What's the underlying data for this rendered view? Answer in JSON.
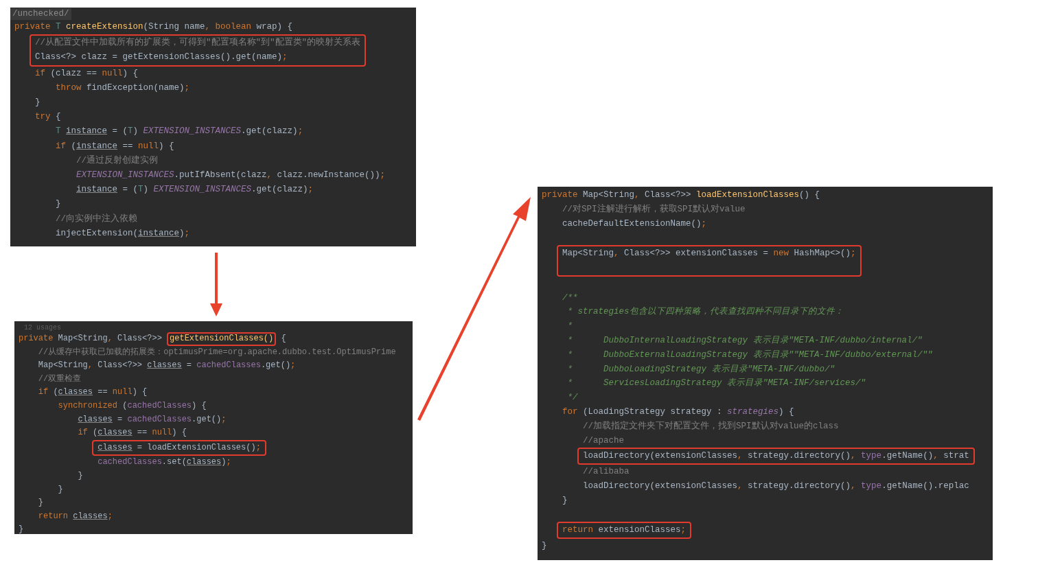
{
  "panels": [
    {
      "header": "/unchecked/",
      "blocks": [
        {
          "boxed": false,
          "lines": [
            {
              "segments": [
                {
                  "kind": "kw",
                  "text": "private "
                },
                {
                  "kind": "tparam",
                  "text": "T "
                },
                {
                  "kind": "method",
                  "text": "createExtension"
                },
                {
                  "kind": "plain",
                  "text": "(String name"
                },
                {
                  "kind": "kw",
                  "text": ", "
                },
                {
                  "kind": "kw",
                  "text": "boolean "
                },
                {
                  "kind": "plain",
                  "text": "wrap) {"
                }
              ]
            }
          ]
        },
        {
          "boxed": true,
          "lines": [
            {
              "kind": "comment",
              "text": "    //从配置文件中加载所有的扩展类，可得到\"配置项名称\"到\"配置类\"的映射关系表"
            },
            {
              "segments": [
                {
                  "kind": "plain",
                  "text": "    Class<?> clazz = getExtensionClasses().get(name)"
                },
                {
                  "kind": "kw",
                  "text": ";"
                }
              ]
            }
          ]
        },
        {
          "boxed": false,
          "lines": [
            {
              "segments": [
                {
                  "kind": "kw",
                  "text": "    if "
                },
                {
                  "kind": "plain",
                  "text": "(clazz == "
                },
                {
                  "kind": "kw",
                  "text": "null"
                },
                {
                  "kind": "plain",
                  "text": ") {"
                }
              ]
            },
            {
              "segments": [
                {
                  "kind": "kw",
                  "text": "        throw "
                },
                {
                  "kind": "plain",
                  "text": "findException(name)"
                },
                {
                  "kind": "kw",
                  "text": ";"
                }
              ]
            },
            {
              "kind": "plain",
              "text": "    }"
            },
            {
              "segments": [
                {
                  "kind": "kw",
                  "text": "    try "
                },
                {
                  "kind": "plain",
                  "text": "{"
                }
              ]
            },
            {
              "segments": [
                {
                  "kind": "tparam",
                  "text": "        T "
                },
                {
                  "kind": "var",
                  "text": "instance"
                },
                {
                  "kind": "plain",
                  "text": " = ("
                },
                {
                  "kind": "tparam",
                  "text": "T"
                },
                {
                  "kind": "plain",
                  "text": ") "
                },
                {
                  "kind": "field",
                  "text": "EXTENSION_INSTANCES"
                },
                {
                  "kind": "plain",
                  "text": ".get(clazz)"
                },
                {
                  "kind": "kw",
                  "text": ";"
                }
              ]
            },
            {
              "segments": [
                {
                  "kind": "kw",
                  "text": "        if "
                },
                {
                  "kind": "plain",
                  "text": "("
                },
                {
                  "kind": "var",
                  "text": "instance"
                },
                {
                  "kind": "plain",
                  "text": " == "
                },
                {
                  "kind": "kw",
                  "text": "null"
                },
                {
                  "kind": "plain",
                  "text": ") {"
                }
              ]
            },
            {
              "kind": "comment",
              "text": "            //通过反射创建实例"
            },
            {
              "segments": [
                {
                  "kind": "field",
                  "text": "            EXTENSION_INSTANCES"
                },
                {
                  "kind": "plain",
                  "text": ".putIfAbsent(clazz"
                },
                {
                  "kind": "kw",
                  "text": ", "
                },
                {
                  "kind": "plain",
                  "text": "clazz.newInstance())"
                },
                {
                  "kind": "kw",
                  "text": ";"
                }
              ]
            },
            {
              "segments": [
                {
                  "kind": "var",
                  "text": "            instance"
                },
                {
                  "kind": "plain",
                  "text": " = ("
                },
                {
                  "kind": "tparam",
                  "text": "T"
                },
                {
                  "kind": "plain",
                  "text": ") "
                },
                {
                  "kind": "field",
                  "text": "EXTENSION_INSTANCES"
                },
                {
                  "kind": "plain",
                  "text": ".get(clazz)"
                },
                {
                  "kind": "kw",
                  "text": ";"
                }
              ]
            },
            {
              "kind": "plain",
              "text": "        }"
            },
            {
              "kind": "comment",
              "text": "        //向实例中注入依赖"
            },
            {
              "segments": [
                {
                  "kind": "plain",
                  "text": "        injectExtension("
                },
                {
                  "kind": "var",
                  "text": "instance"
                },
                {
                  "kind": "plain",
                  "text": ")"
                },
                {
                  "kind": "kw",
                  "text": ";"
                }
              ]
            }
          ]
        }
      ]
    },
    {
      "usages": "12 usages",
      "blocks": [
        {
          "boxed": false,
          "lines": [
            {
              "segments": [
                {
                  "kind": "kw",
                  "text": "private "
                },
                {
                  "kind": "plain",
                  "text": "Map<String"
                },
                {
                  "kind": "kw",
                  "text": ", "
                },
                {
                  "kind": "plain",
                  "text": "Class<?>> "
                },
                {
                  "kind": "method",
                  "text": "getExtensionClasses()",
                  "boxed": true
                },
                {
                  "kind": "plain",
                  "text": " {"
                }
              ]
            },
            {
              "kind": "comment",
              "text": "    //从缓存中获取已加载的拓展类：optimusPrime=org.apache.dubbo.test.OptimusPrime"
            },
            {
              "segments": [
                {
                  "kind": "plain",
                  "text": "    Map<String"
                },
                {
                  "kind": "kw",
                  "text": ", "
                },
                {
                  "kind": "plain",
                  "text": "Class<?>> "
                },
                {
                  "kind": "var",
                  "text": "classes"
                },
                {
                  "kind": "plain",
                  "text": " = "
                },
                {
                  "kind": "member",
                  "text": "cachedClasses"
                },
                {
                  "kind": "plain",
                  "text": ".get()"
                },
                {
                  "kind": "kw",
                  "text": ";"
                }
              ]
            },
            {
              "kind": "comment",
              "text": "    //双重检查"
            },
            {
              "segments": [
                {
                  "kind": "kw",
                  "text": "    if "
                },
                {
                  "kind": "plain",
                  "text": "("
                },
                {
                  "kind": "var",
                  "text": "classes"
                },
                {
                  "kind": "plain",
                  "text": " == "
                },
                {
                  "kind": "kw",
                  "text": "null"
                },
                {
                  "kind": "plain",
                  "text": ") {"
                }
              ]
            },
            {
              "segments": [
                {
                  "kind": "kw",
                  "text": "        synchronized "
                },
                {
                  "kind": "plain",
                  "text": "("
                },
                {
                  "kind": "member",
                  "text": "cachedClasses"
                },
                {
                  "kind": "plain",
                  "text": ") {"
                }
              ]
            },
            {
              "segments": [
                {
                  "kind": "var",
                  "text": "            classes"
                },
                {
                  "kind": "plain",
                  "text": " = "
                },
                {
                  "kind": "member",
                  "text": "cachedClasses"
                },
                {
                  "kind": "plain",
                  "text": ".get()"
                },
                {
                  "kind": "kw",
                  "text": ";"
                }
              ]
            },
            {
              "segments": [
                {
                  "kind": "kw",
                  "text": "            if "
                },
                {
                  "kind": "plain",
                  "text": "("
                },
                {
                  "kind": "var",
                  "text": "classes"
                },
                {
                  "kind": "plain",
                  "text": " == "
                },
                {
                  "kind": "kw",
                  "text": "null"
                },
                {
                  "kind": "plain",
                  "text": ") {"
                }
              ]
            }
          ]
        },
        {
          "boxed": true,
          "lines": [
            {
              "segments": [
                {
                  "kind": "var",
                  "text": "                classes"
                },
                {
                  "kind": "plain",
                  "text": " = loadExtensionClasses()"
                },
                {
                  "kind": "kw",
                  "text": ";"
                }
              ]
            }
          ]
        },
        {
          "boxed": false,
          "lines": [
            {
              "segments": [
                {
                  "kind": "member",
                  "text": "                cachedClasses"
                },
                {
                  "kind": "plain",
                  "text": ".set("
                },
                {
                  "kind": "var",
                  "text": "classes"
                },
                {
                  "kind": "plain",
                  "text": ")"
                },
                {
                  "kind": "kw",
                  "text": ";"
                }
              ]
            },
            {
              "kind": "plain",
              "text": "            }"
            },
            {
              "kind": "plain",
              "text": "        }"
            },
            {
              "kind": "plain",
              "text": "    }"
            },
            {
              "segments": [
                {
                  "kind": "kw",
                  "text": "    return "
                },
                {
                  "kind": "var",
                  "text": "classes"
                },
                {
                  "kind": "kw",
                  "text": ";"
                }
              ]
            },
            {
              "kind": "plain",
              "text": "}"
            }
          ]
        }
      ]
    },
    {
      "blocks": [
        {
          "boxed": false,
          "lines": [
            {
              "segments": [
                {
                  "kind": "kw",
                  "text": "private "
                },
                {
                  "kind": "plain",
                  "text": "Map<String"
                },
                {
                  "kind": "kw",
                  "text": ", "
                },
                {
                  "kind": "plain",
                  "text": "Class<?>> "
                },
                {
                  "kind": "method",
                  "text": "loadExtensionClasses"
                },
                {
                  "kind": "plain",
                  "text": "() {"
                }
              ]
            },
            {
              "kind": "comment",
              "text": "    //对SPI注解进行解析，获取SPI默认对value"
            },
            {
              "segments": [
                {
                  "kind": "plain",
                  "text": "    cacheDefaultExtensionName()"
                },
                {
                  "kind": "kw",
                  "text": ";"
                }
              ]
            },
            {
              "kind": "blank"
            }
          ]
        },
        {
          "boxed": true,
          "lines": [
            {
              "segments": [
                {
                  "kind": "plain",
                  "text": "    Map<String"
                },
                {
                  "kind": "kw",
                  "text": ", "
                },
                {
                  "kind": "plain",
                  "text": "Class<?>> extensionClasses = "
                },
                {
                  "kind": "kw",
                  "text": "new "
                },
                {
                  "kind": "plain",
                  "text": "HashMap<>()"
                },
                {
                  "kind": "kw",
                  "text": ";"
                }
              ]
            },
            {
              "kind": "blank"
            }
          ]
        },
        {
          "boxed": false,
          "lines": [
            {
              "kind": "blank"
            },
            {
              "kind": "doc",
              "text": "    /**"
            },
            {
              "kind": "doc",
              "text": "     * strategies包含以下四种策略，代表查找四种不同目录下的文件："
            },
            {
              "kind": "doc",
              "text": "     *"
            },
            {
              "kind": "doc",
              "text": "     *      DubboInternalLoadingStrategy 表示目录\"META-INF/dubbo/internal/\""
            },
            {
              "kind": "doc",
              "text": "     *      DubboExternalLoadingStrategy 表示目录\"\"META-INF/dubbo/external/\"\""
            },
            {
              "kind": "doc",
              "text": "     *      DubboLoadingStrategy 表示目录\"META-INF/dubbo/\""
            },
            {
              "kind": "doc",
              "text": "     *      ServicesLoadingStrategy 表示目录\"META-INF/services/\""
            },
            {
              "kind": "doc",
              "text": "     */"
            },
            {
              "segments": [
                {
                  "kind": "kw",
                  "text": "    for "
                },
                {
                  "kind": "plain",
                  "text": "(LoadingStrategy strategy : "
                },
                {
                  "kind": "field",
                  "text": "strategies"
                },
                {
                  "kind": "plain",
                  "text": ") {"
                }
              ]
            },
            {
              "kind": "comment",
              "text": "        //加载指定文件夹下对配置文件，找到SPI默认对value的class"
            },
            {
              "kind": "comment",
              "text": "        //apache"
            }
          ]
        },
        {
          "boxed": true,
          "lines": [
            {
              "segments": [
                {
                  "kind": "plain",
                  "text": "        loadDirectory(extensionClasses"
                },
                {
                  "kind": "kw",
                  "text": ", "
                },
                {
                  "kind": "plain",
                  "text": "strategy.directory()"
                },
                {
                  "kind": "kw",
                  "text": ", "
                },
                {
                  "kind": "member",
                  "text": "type"
                },
                {
                  "kind": "plain",
                  "text": ".getName()"
                },
                {
                  "kind": "kw",
                  "text": ", "
                },
                {
                  "kind": "plain",
                  "text": "strat"
                }
              ]
            }
          ]
        },
        {
          "boxed": false,
          "lines": [
            {
              "kind": "comment",
              "text": "        //alibaba"
            },
            {
              "segments": [
                {
                  "kind": "plain",
                  "text": "        loadDirectory(extensionClasses"
                },
                {
                  "kind": "kw",
                  "text": ", "
                },
                {
                  "kind": "plain",
                  "text": "strategy.directory()"
                },
                {
                  "kind": "kw",
                  "text": ", "
                },
                {
                  "kind": "member",
                  "text": "type"
                },
                {
                  "kind": "plain",
                  "text": ".getName().replac"
                }
              ]
            },
            {
              "kind": "plain",
              "text": "    }"
            },
            {
              "kind": "blank"
            }
          ]
        },
        {
          "boxed": true,
          "lines": [
            {
              "segments": [
                {
                  "kind": "kw",
                  "text": "    return "
                },
                {
                  "kind": "plain",
                  "text": "extensionClasses"
                },
                {
                  "kind": "kw",
                  "text": ";"
                }
              ]
            }
          ]
        },
        {
          "boxed": false,
          "lines": [
            {
              "kind": "plain",
              "text": "}"
            }
          ]
        }
      ]
    }
  ]
}
